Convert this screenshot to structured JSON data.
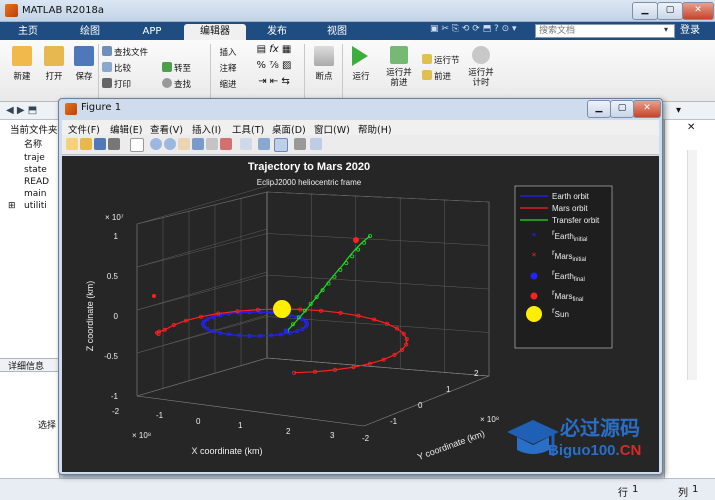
{
  "app": {
    "title": "MATLAB R2018a",
    "accent": "#1f4d82"
  },
  "tabs": [
    {
      "label": "主页"
    },
    {
      "label": "绘图"
    },
    {
      "label": "APP"
    },
    {
      "label": "编辑器"
    },
    {
      "label": "发布"
    },
    {
      "label": "视图"
    }
  ],
  "search": {
    "placeholder": "搜索文档"
  },
  "login": {
    "label": "登录"
  },
  "ribbon": {
    "new": "新建",
    "open": "打开",
    "save": "保存",
    "find_files": "查找文件",
    "compare": "比较",
    "print": "打印",
    "goto": "转至",
    "find": "查找",
    "insert": "插入",
    "comment": "注释",
    "indent": "缩进",
    "breakpoint": "断点",
    "run": "运行",
    "run_advance": "运行并\n前进",
    "run_section": "运行节",
    "advance": "前进",
    "run_time": "运行并\n计时"
  },
  "left_panel": {
    "title": "当前文件夹",
    "name_col": "名称",
    "files": [
      "traje",
      "state",
      "READ",
      "main",
      "utiliti"
    ],
    "details": "详细信息",
    "select": "选择"
  },
  "right_panel": {
    "line_numbers": [
      "1",
      "2"
    ]
  },
  "status": {
    "line_label": "行",
    "line": "1",
    "col_label": "列",
    "col": "1"
  },
  "figure": {
    "title": "Figure 1",
    "menu": [
      "文件(F)",
      "编辑(E)",
      "查看(V)",
      "插入(I)",
      "工具(T)",
      "桌面(D)",
      "窗口(W)",
      "帮助(H)"
    ]
  },
  "chart_data": {
    "type": "line",
    "title": "Trajectory to Mars 2020",
    "subtitle": "EclipJ2000 heliocentric frame",
    "xlabel": "X coordinate (km)",
    "ylabel": "Y coordinate (km)",
    "zlabel": "Z coordinate (km)",
    "x_exponent": "× 10⁸",
    "y_exponent": "× 10⁸",
    "z_exponent": "× 10⁷",
    "x_ticks": [
      "-2",
      "-1",
      "0",
      "1",
      "2",
      "3"
    ],
    "y_ticks": [
      "-2",
      "-1",
      "0",
      "1",
      "2"
    ],
    "z_ticks": [
      "-1",
      "-0.5",
      "0",
      "0.5",
      "1"
    ],
    "grid": true,
    "legend_position": "top-right",
    "legend": [
      {
        "label": "Earth orbit",
        "color": "#2222ff",
        "marker": "line"
      },
      {
        "label": "Mars orbit",
        "color": "#ff2020",
        "marker": "line"
      },
      {
        "label": "Transfer orbit",
        "color": "#22dd22",
        "marker": "line"
      },
      {
        "label": "r",
        "sub": "Earth",
        "subsub": "initial",
        "color": "#2222ff",
        "marker": "star"
      },
      {
        "label": "r",
        "sub": "Mars",
        "subsub": "initial",
        "color": "#ff2020",
        "marker": "star"
      },
      {
        "label": "r",
        "sub": "Earth",
        "subsub": "final",
        "color": "#2222ff",
        "marker": "dot"
      },
      {
        "label": "r",
        "sub": "Mars",
        "subsub": "final",
        "color": "#ff2020",
        "marker": "dot"
      },
      {
        "label": "r",
        "sub": "Sun",
        "subsub": "",
        "color": "#ffee00",
        "marker": "bigdot"
      }
    ]
  }
}
